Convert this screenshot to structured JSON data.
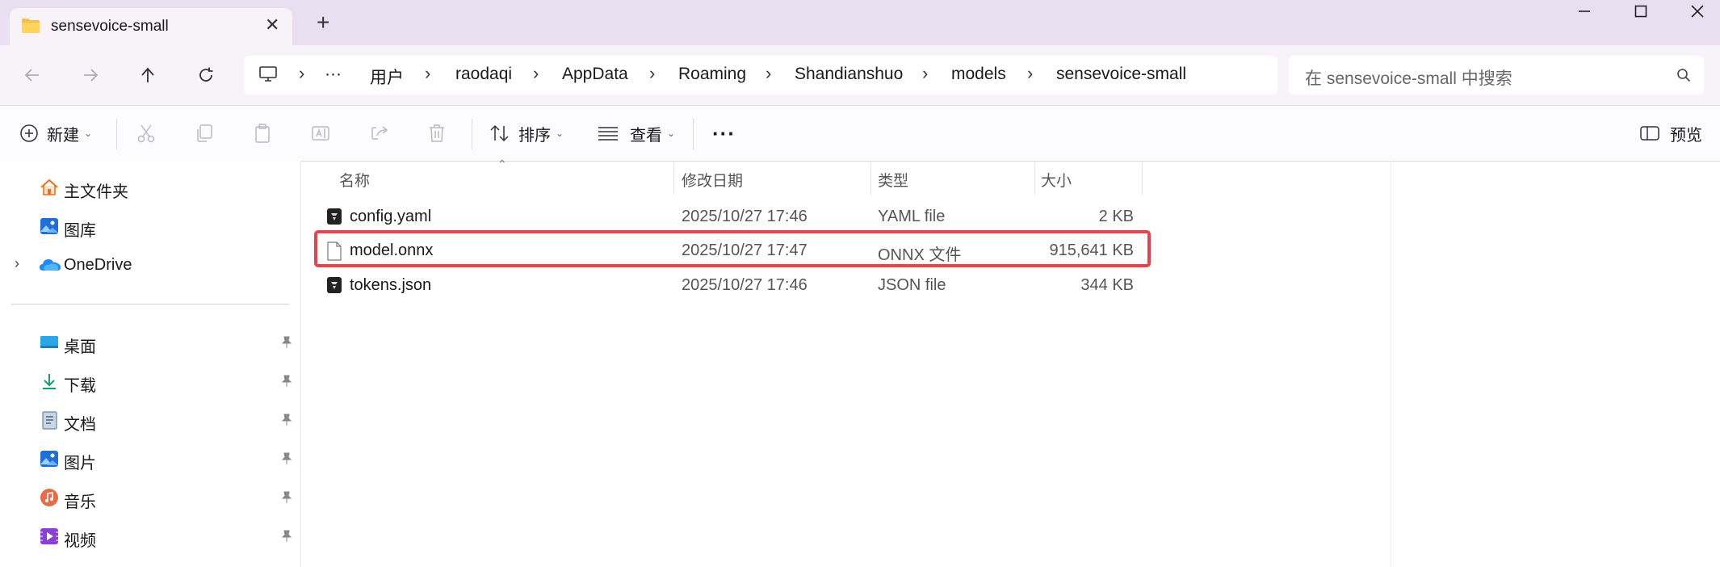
{
  "window": {
    "tab_title": "sensevoice-small",
    "new_tab": "+",
    "close_tab": "✕"
  },
  "address": {
    "overflow": "···",
    "breadcrumbs": [
      "用户",
      "raodaqi",
      "AppData",
      "Roaming",
      "Shandianshuo",
      "models",
      "sensevoice-small"
    ],
    "search_placeholder": "在 sensevoice-small 中搜索"
  },
  "commandbar": {
    "new_label": "新建",
    "sort_label": "排序",
    "view_label": "查看",
    "more_label": "···",
    "preview_label": "预览"
  },
  "sidebar": {
    "home": "主文件夹",
    "gallery": "图库",
    "onedrive": "OneDrive",
    "pinned": [
      "桌面",
      "下载",
      "文档",
      "图片",
      "音乐",
      "视频"
    ]
  },
  "filelist": {
    "columns": {
      "name": "名称",
      "modified": "修改日期",
      "type": "类型",
      "size": "大小"
    },
    "rows": [
      {
        "name": "config.yaml",
        "modified": "2025/10/27 17:46",
        "type": "YAML file",
        "size": "2 KB",
        "icon": "app-file-icon"
      },
      {
        "name": "model.onnx",
        "modified": "2025/10/27 17:47",
        "type": "ONNX 文件",
        "size": "915,641 KB",
        "icon": "blank-file-icon"
      },
      {
        "name": "tokens.json",
        "modified": "2025/10/27 17:46",
        "type": "JSON file",
        "size": "344 KB",
        "icon": "app-file-icon"
      }
    ],
    "highlight_color": "#e8434d"
  }
}
